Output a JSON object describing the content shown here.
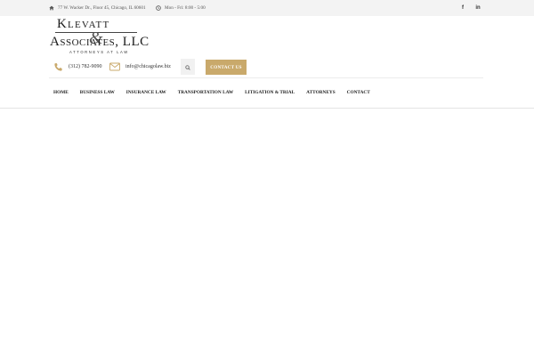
{
  "topbar": {
    "address": "77 W. Wacker Dr., Floor 45, Chicago, IL 60601",
    "hours": "Mon - Fri: 8:00 - 5:00",
    "social": [
      {
        "name": "facebook",
        "glyph": "f"
      },
      {
        "name": "linkedin",
        "glyph": "in"
      }
    ],
    "icons": {
      "address": "home-icon",
      "hours": "clock-icon"
    }
  },
  "logo": {
    "line1": "Klevatt",
    "ampersand": "&",
    "line2": "Associates, LLC",
    "tagline": "ATTORNEYS AT LAW"
  },
  "contact": {
    "phone": "(312) 782-9090",
    "email": "info@chicagolaw.biz",
    "button_label": "CONTACT US"
  },
  "nav": {
    "items": [
      "HOME",
      "BUSINESS LAW",
      "INSURANCE LAW",
      "TRANSPORTATION LAW",
      "LITIGATION & TRIAL",
      "ATTORNEYS",
      "CONTACT"
    ]
  },
  "colors": {
    "accent": "#c9a96b",
    "topbar_bg": "#f3f3f3",
    "text": "#1c1c1c"
  }
}
